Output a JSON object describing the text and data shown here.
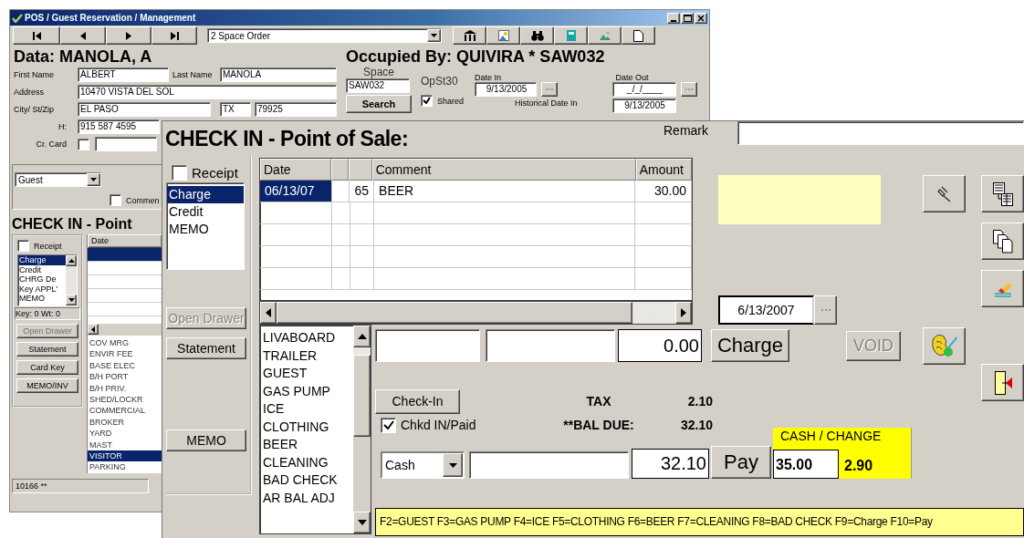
{
  "back_window": {
    "title": "POS / Guest Reservation / Management",
    "order_dropdown": {
      "value": "2 Space Order"
    },
    "heading": "Data: MANOLA, A",
    "first_name": {
      "label": "First Name",
      "value": "ALBERT"
    },
    "last_name": {
      "label": "Last Name",
      "value": "MANOLA"
    },
    "address": {
      "label": "Address",
      "value": "10470 VISTA DEL SOL"
    },
    "city_st_zip": {
      "label": "City/ St/Zip",
      "city": "EL PASO",
      "state": "TX",
      "zip": "79925"
    },
    "phone": {
      "label": "H:",
      "value": "915 587 4595"
    },
    "card": {
      "label": "Cr. Card",
      "checked": false
    },
    "occupied_heading": "Occupied By: QUIVIRA * SAW032",
    "space": {
      "label": "Space",
      "value": "SAW032"
    },
    "search_button": "Search",
    "op_label": "OpSt30",
    "shared": {
      "label": "Shared",
      "checked": true
    },
    "date_in": {
      "label": "Date In",
      "value": "9/13/2005"
    },
    "date_out": {
      "label": "Date Out",
      "value": "_/_/____"
    },
    "historical": {
      "label": "Historical Date In",
      "value": "9/13/2005"
    },
    "type_dropdown": {
      "value": "Guest"
    },
    "comment_checkbox": {
      "label": "Commen",
      "checked": false
    },
    "checkin_heading": "CHECK IN - Point",
    "receipt": {
      "label": "Receipt",
      "checked": false
    },
    "modes": [
      {
        "label": "Charge",
        "selected": true
      },
      {
        "label": "Credit",
        "selected": false
      },
      {
        "label": "CHRG De",
        "selected": false
      },
      {
        "label": "Key APPL'",
        "selected": false
      },
      {
        "label": "MEMO",
        "selected": false
      }
    ],
    "key_info": "Key: 0 Wt: 0",
    "buttons": [
      {
        "label": "Open Drawer",
        "disabled": true
      },
      {
        "label": "Statement",
        "disabled": false
      },
      {
        "label": "Card Key",
        "disabled": false
      },
      {
        "label": "MEMO/INV",
        "disabled": false
      }
    ],
    "grid": {
      "column": "Date",
      "rows": [
        {
          "selected": true
        },
        {
          "selected": false
        },
        {
          "selected": false
        },
        {
          "selected": false
        },
        {
          "selected": false
        }
      ]
    },
    "items": [
      {
        "label": "COV MRG",
        "selected": false
      },
      {
        "label": "ENVIR FEE",
        "selected": false
      },
      {
        "label": "BASE ELEC",
        "selected": false
      },
      {
        "label": "B/H PORT",
        "selected": false
      },
      {
        "label": "B/H PRIV.",
        "selected": false
      },
      {
        "label": "SHED/LOCKR",
        "selected": false
      },
      {
        "label": "COMMERCIAL",
        "selected": false
      },
      {
        "label": "BROKER",
        "selected": false
      },
      {
        "label": "YARD",
        "selected": false
      },
      {
        "label": "MAST",
        "selected": false
      },
      {
        "label": "VISITOR",
        "selected": true
      },
      {
        "label": "PARKING",
        "selected": false
      }
    ],
    "status": "10166 **"
  },
  "pos_window": {
    "title": "CHECK IN - Point of Sale:",
    "remark_label": "Remark",
    "receipt": {
      "label": "Receipt",
      "checked": false
    },
    "modes": [
      {
        "label": "Charge",
        "selected": true
      },
      {
        "label": "Credit",
        "selected": false
      },
      {
        "label": "MEMO",
        "selected": false
      }
    ],
    "buttons": [
      {
        "label": "Open Drawer",
        "disabled": true
      },
      {
        "label": "Statement",
        "disabled": false
      },
      {
        "label": "MEMO",
        "disabled": false
      }
    ],
    "table": {
      "columns": [
        {
          "kind": "text",
          "label": "Date"
        },
        {
          "kind": "blank"
        },
        {
          "kind": "blank"
        },
        {
          "kind": "text",
          "label": "Comment"
        },
        {
          "kind": "number",
          "label": "Amount"
        }
      ],
      "rows": [
        {
          "selected": true,
          "cells": [
            "06/13/07",
            null,
            "65",
            "BEER",
            "30.00"
          ]
        }
      ]
    },
    "items": [
      "LIVABOARD",
      "TRAILER",
      "GUEST",
      "GAS PUMP",
      "ICE",
      "CLOTHING",
      "BEER",
      "CLEANING",
      "BAD CHECK",
      "AR BAL ADJ"
    ],
    "charge_amount": "0.00",
    "charge_button": "Charge",
    "date": "6/13/2007",
    "void_button": {
      "label": "VOID",
      "disabled": true
    },
    "checkin_button": "Check-In",
    "paid": {
      "label": "Chkd IN/Paid",
      "checked": true
    },
    "tax": {
      "label": "TAX",
      "value": "2.10"
    },
    "bal_due": {
      "label": "**BAL DUE:",
      "value": "32.10"
    },
    "payment": {
      "method": "Cash",
      "amount": "32.10"
    },
    "pay_button": "Pay",
    "cash_change": {
      "title": "CASH / CHANGE",
      "tendered": "35.00",
      "change": "2.90"
    },
    "hint": "F2=GUEST F3=GAS PUMP F4=ICE F5=CLOTHING F6=BEER F7=CLEANING F8=BAD CHECK F9=Charge F10=Pay"
  }
}
